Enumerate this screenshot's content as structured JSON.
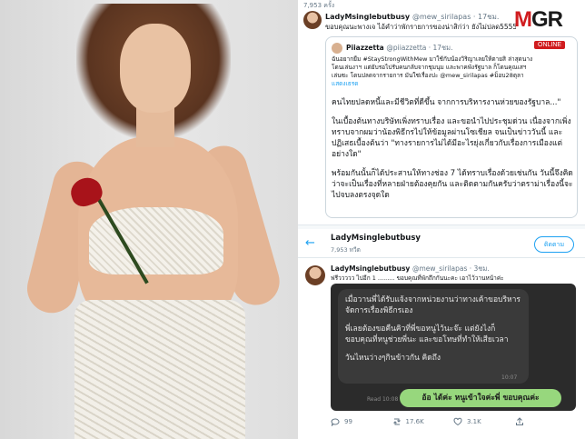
{
  "tweet1": {
    "views": "7,953 ครั้ง",
    "display_name": "LadyMsinglebutbusy",
    "handle": "@mew_sirilapas · 17ชม.",
    "text": "ขอบคุณนะพางเจ ไอ้คำว่าพักรายการของน่าสิก่ว่า ยังไม่ปลด5555",
    "quote": {
      "name": "Piiazzetta",
      "handle": "@piiazzetta · 17ชม.",
      "line1": "ฉันอยากยืม #StayStrongWithMew มาใช้กับน้องวิริญาเลยให้ตายสิ ล่าสุดนาง",
      "line2": "โดนเล่นงาฯ แต่ยับรอไปรับคนกลับจากชุมนุม และพาคพังรัฐบาล ก็โดนคุณเสฯ",
      "line3": "เล่นซะ โดนปลดจากรายการ มันใช่เรื่องปะ @mew_sirilapas #ม็อบ28ตุลา",
      "more": "แสดงเธรด",
      "para1": "คนไทยปลดหนี้และมีชีวิตที่ดีขึ้น จากการบริหารงานห่วยของรัฐบาล...\"",
      "para2": "ในเบื้องต้นทางบริษัทเพิ่งทราบเรื่อง และขอนำไปประชุมด่วน เนื่องจากเพิ่งทราบจากผมว่าน้องพิธีกรไปให้ข้อมูลผ่านโซเชียล จนเป็นข่าววันนี้ และปฏิเสธเบื้องต้นว่า \"ทางรายการไม่ได้มีอะไรยุ่งเกี่ยวกับเรื่องการเมืองแต่อย่างใด\"",
      "para3": "พร้อมกันนั้นก็ได้ประสานให้ทางช่อง 7 ได้ทราบเรื่องด้วยเช่นกัน วันนี้จึงคิดว่าจะเป็นเรื่องที่หลายฝ่ายต้องคุยกัน และติดตามกันครับว่าตราม่าเรื่องนี้จะไปจบลงตรงจุดใด"
    }
  },
  "tweet2": {
    "header_title": "LadyMsinglebutbusy",
    "header_views": "7,953 ทวีต",
    "follow_label": "ติดตาม",
    "display_name": "LadyMsinglebutbusy",
    "handle": "@mew_sirilapas · 3ชม.",
    "text": "ฟรีววววว ไปอีก 1 ......... ขอบคุณที่พักถึกกันนะคะ เอาไว้วานหน้าค่ะ",
    "chat": {
      "incoming_p1": "เมื่อวานพี่ได้รับแจ้งจากหน่วยงานว่าทางเค้าขอบริหารจัดการเรื่องพิธีกรเอง",
      "incoming_p2": "พี่เลยต้องขอคืนคิวที่พี่ขอหนูไว้นะจ๊ะ แต่ยังไงก็ขอบคุณที่หนูช่วยพี่นะ และขอโทษที่ทำให้เสียเวลา",
      "incoming_p3": "วันไหนว่างๆกินข้าวกัน คิดถึง",
      "incoming_time": "10:07",
      "outgoing": "อ้อ ได้ค่ะ หนูเข้าใจค่ะพี่ ขอบคุณค่ะ",
      "outgoing_read": "Read 10:08"
    },
    "actions": {
      "reply_count": "99",
      "retweet_count": "17.6K",
      "like_count": "3.1K"
    }
  },
  "logo": {
    "text_m": "M",
    "text_gr": "GR",
    "online": "ONLINE"
  },
  "colors": {
    "twitter_blue": "#1da1f2",
    "line_green": "#97d77d",
    "mgr_red": "#d01c1f"
  }
}
